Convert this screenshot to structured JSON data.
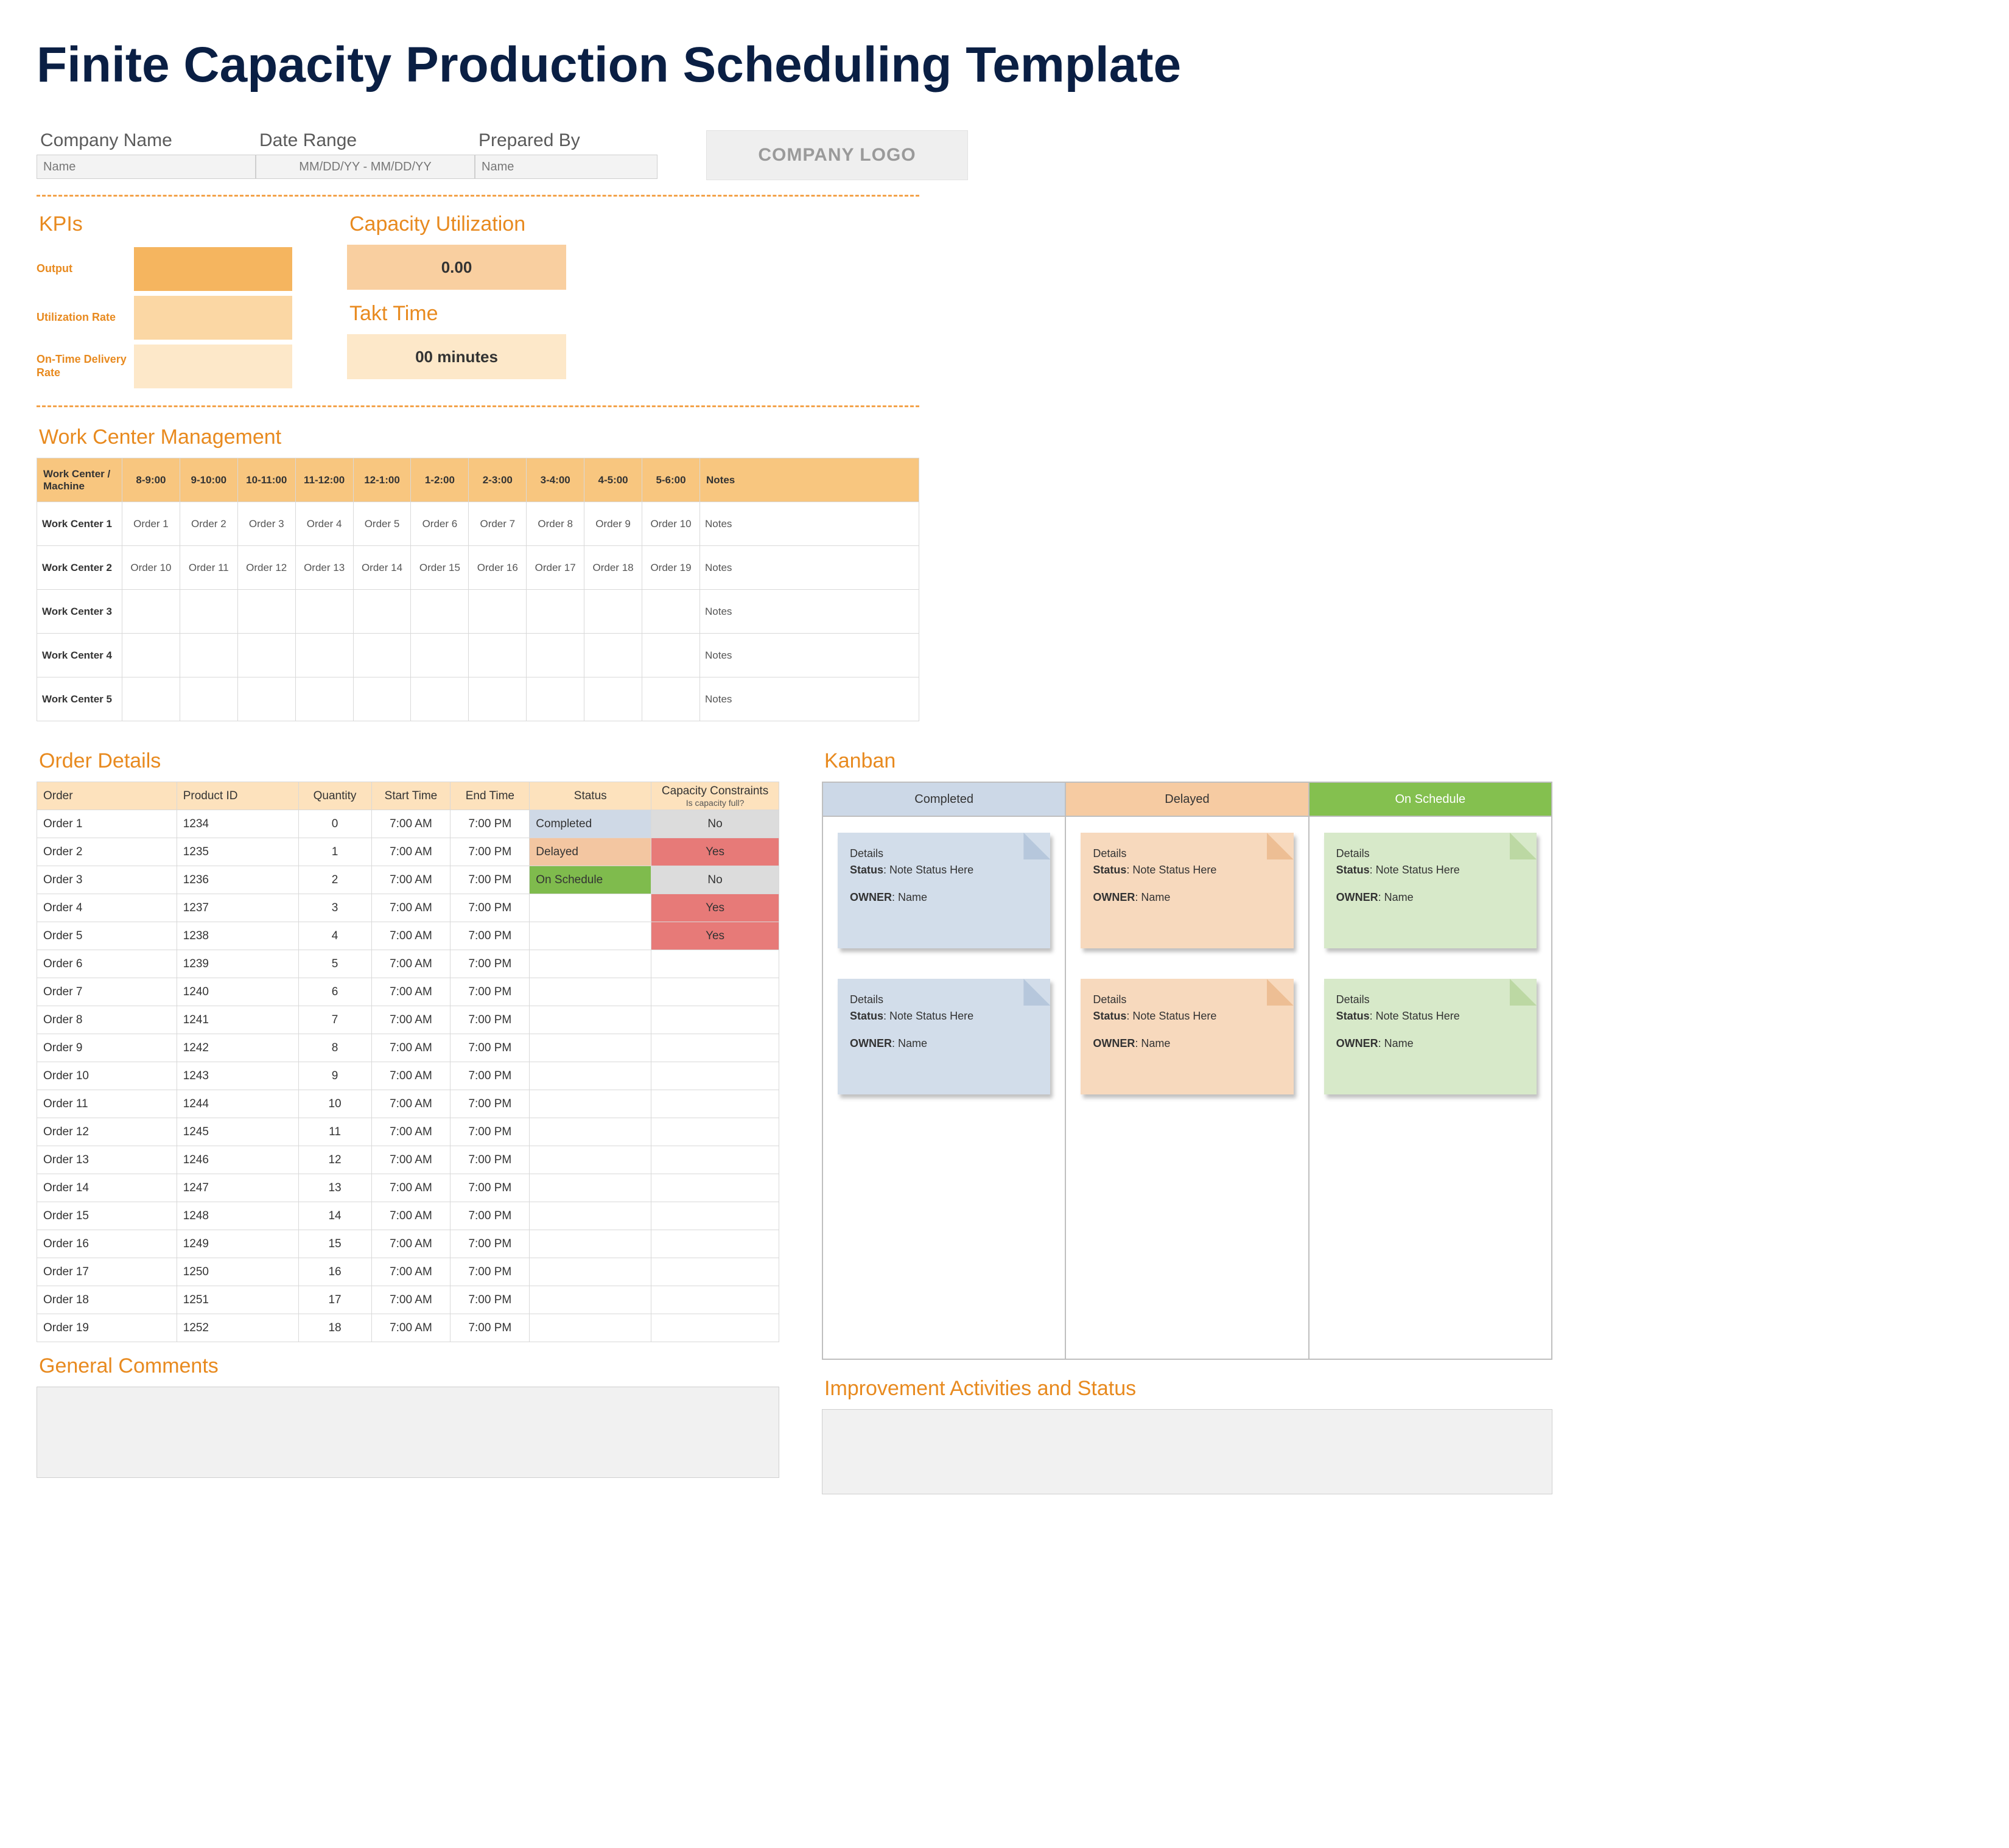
{
  "title": "Finite Capacity Production Scheduling Template",
  "meta": {
    "company_label": "Company Name",
    "company_value": "Name",
    "date_label": "Date Range",
    "date_value": "MM/DD/YY - MM/DD/YY",
    "prepared_label": "Prepared By",
    "prepared_value": "Name",
    "logo_text": "COMPANY LOGO"
  },
  "kpi": {
    "heading": "KPIs",
    "rows": [
      {
        "label": "Output"
      },
      {
        "label": "Utilization Rate"
      },
      {
        "label": "On-Time Delivery Rate"
      }
    ],
    "cap_heading": "Capacity Utilization",
    "cap_value": "0.00",
    "takt_heading": "Takt Time",
    "takt_value": "00 minutes"
  },
  "work_center": {
    "heading": "Work Center Management",
    "first_col": "Work Center / Machine",
    "slots": [
      "8-9:00",
      "9-10:00",
      "10-11:00",
      "11-12:00",
      "12-1:00",
      "1-2:00",
      "2-3:00",
      "3-4:00",
      "4-5:00",
      "5-6:00"
    ],
    "notes_col": "Notes",
    "rows": [
      {
        "name": "Work Center 1",
        "cells": [
          "Order 1",
          "Order 2",
          "Order 3",
          "Order 4",
          "Order 5",
          "Order 6",
          "Order 7",
          "Order 8",
          "Order 9",
          "Order 10"
        ],
        "notes": "Notes"
      },
      {
        "name": "Work Center 2",
        "cells": [
          "Order 10",
          "Order 11",
          "Order 12",
          "Order 13",
          "Order 14",
          "Order 15",
          "Order 16",
          "Order 17",
          "Order 18",
          "Order 19"
        ],
        "notes": "Notes"
      },
      {
        "name": "Work Center 3",
        "cells": [
          "",
          "",
          "",
          "",
          "",
          "",
          "",
          "",
          "",
          ""
        ],
        "notes": "Notes"
      },
      {
        "name": "Work Center 4",
        "cells": [
          "",
          "",
          "",
          "",
          "",
          "",
          "",
          "",
          "",
          ""
        ],
        "notes": "Notes"
      },
      {
        "name": "Work Center 5",
        "cells": [
          "",
          "",
          "",
          "",
          "",
          "",
          "",
          "",
          "",
          ""
        ],
        "notes": "Notes"
      }
    ]
  },
  "order_details": {
    "heading": "Order Details",
    "cols": {
      "order": "Order",
      "product": "Product ID",
      "qty": "Quantity",
      "start": "Start Time",
      "end": "End Time",
      "status": "Status",
      "cap": "Capacity Constraints",
      "cap_sub": "Is capacity full?"
    },
    "rows": [
      {
        "order": "Order 1",
        "product": "1234",
        "qty": "0",
        "start": "7:00 AM",
        "end": "7:00 PM",
        "status": "Completed",
        "cap": "No"
      },
      {
        "order": "Order 2",
        "product": "1235",
        "qty": "1",
        "start": "7:00 AM",
        "end": "7:00 PM",
        "status": "Delayed",
        "cap": "Yes"
      },
      {
        "order": "Order 3",
        "product": "1236",
        "qty": "2",
        "start": "7:00 AM",
        "end": "7:00 PM",
        "status": "On Schedule",
        "cap": "No"
      },
      {
        "order": "Order 4",
        "product": "1237",
        "qty": "3",
        "start": "7:00 AM",
        "end": "7:00 PM",
        "status": "",
        "cap": "Yes"
      },
      {
        "order": "Order 5",
        "product": "1238",
        "qty": "4",
        "start": "7:00 AM",
        "end": "7:00 PM",
        "status": "",
        "cap": "Yes"
      },
      {
        "order": "Order 6",
        "product": "1239",
        "qty": "5",
        "start": "7:00 AM",
        "end": "7:00 PM",
        "status": "",
        "cap": ""
      },
      {
        "order": "Order 7",
        "product": "1240",
        "qty": "6",
        "start": "7:00 AM",
        "end": "7:00 PM",
        "status": "",
        "cap": ""
      },
      {
        "order": "Order 8",
        "product": "1241",
        "qty": "7",
        "start": "7:00 AM",
        "end": "7:00 PM",
        "status": "",
        "cap": ""
      },
      {
        "order": "Order 9",
        "product": "1242",
        "qty": "8",
        "start": "7:00 AM",
        "end": "7:00 PM",
        "status": "",
        "cap": ""
      },
      {
        "order": "Order 10",
        "product": "1243",
        "qty": "9",
        "start": "7:00 AM",
        "end": "7:00 PM",
        "status": "",
        "cap": ""
      },
      {
        "order": "Order 11",
        "product": "1244",
        "qty": "10",
        "start": "7:00 AM",
        "end": "7:00 PM",
        "status": "",
        "cap": ""
      },
      {
        "order": "Order 12",
        "product": "1245",
        "qty": "11",
        "start": "7:00 AM",
        "end": "7:00 PM",
        "status": "",
        "cap": ""
      },
      {
        "order": "Order 13",
        "product": "1246",
        "qty": "12",
        "start": "7:00 AM",
        "end": "7:00 PM",
        "status": "",
        "cap": ""
      },
      {
        "order": "Order 14",
        "product": "1247",
        "qty": "13",
        "start": "7:00 AM",
        "end": "7:00 PM",
        "status": "",
        "cap": ""
      },
      {
        "order": "Order 15",
        "product": "1248",
        "qty": "14",
        "start": "7:00 AM",
        "end": "7:00 PM",
        "status": "",
        "cap": ""
      },
      {
        "order": "Order 16",
        "product": "1249",
        "qty": "15",
        "start": "7:00 AM",
        "end": "7:00 PM",
        "status": "",
        "cap": ""
      },
      {
        "order": "Order 17",
        "product": "1250",
        "qty": "16",
        "start": "7:00 AM",
        "end": "7:00 PM",
        "status": "",
        "cap": ""
      },
      {
        "order": "Order 18",
        "product": "1251",
        "qty": "17",
        "start": "7:00 AM",
        "end": "7:00 PM",
        "status": "",
        "cap": ""
      },
      {
        "order": "Order 19",
        "product": "1252",
        "qty": "18",
        "start": "7:00 AM",
        "end": "7:00 PM",
        "status": "",
        "cap": ""
      }
    ]
  },
  "general_comments_heading": "General Comments",
  "kanban": {
    "heading": "Kanban",
    "cols": [
      {
        "key": "completed",
        "label": "Completed"
      },
      {
        "key": "delayed",
        "label": "Delayed"
      },
      {
        "key": "onschedule",
        "label": "On Schedule"
      }
    ],
    "card": {
      "details": "Details",
      "status_label": "Status",
      "status_value": "Note Status Here",
      "owner_label": "OWNER",
      "owner_value": "Name"
    }
  },
  "improvement_heading": "Improvement Activities and Status"
}
